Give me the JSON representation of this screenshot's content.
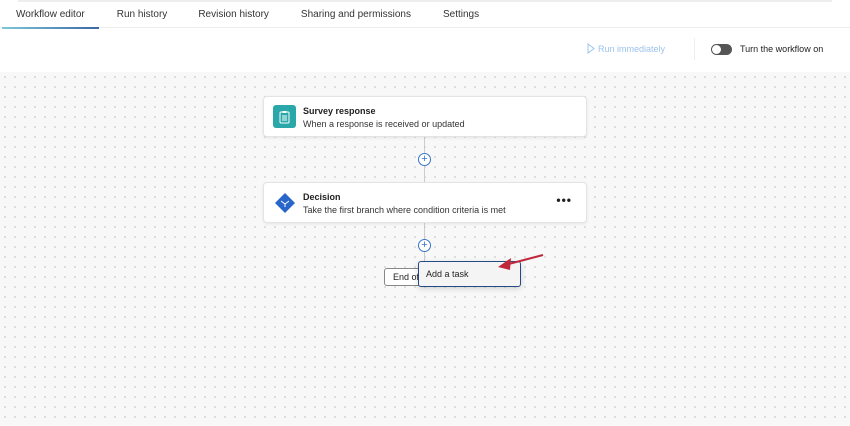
{
  "tabs": [
    "Workflow editor",
    "Run history",
    "Revision history",
    "Sharing and permissions",
    "Settings"
  ],
  "toolbar": {
    "run_label": "Run immediately",
    "toggle_label": "Turn the workflow on",
    "toggle_on": false
  },
  "nodes": [
    {
      "title": "Survey response",
      "subtitle": "When a response is received or updated",
      "icon": "clipboard-icon",
      "color": "#2aa7a8"
    },
    {
      "title": "Decision",
      "subtitle": "Take the first branch where condition criteria is met",
      "icon": "branch-diamond-icon",
      "color": "#2966c9"
    }
  ],
  "end_label": "End of",
  "menu": {
    "add_task": "Add a task"
  },
  "colors": {
    "accent": "#3a74c7",
    "arrow": "#c0283a"
  }
}
